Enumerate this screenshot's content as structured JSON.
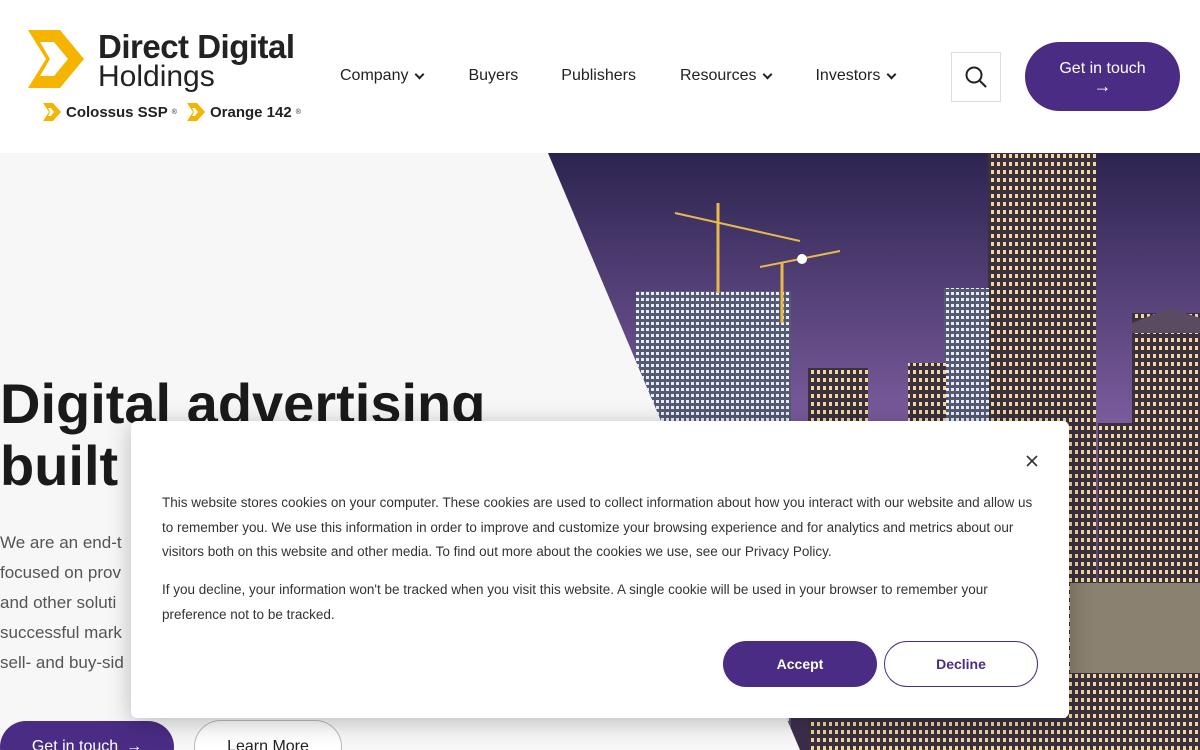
{
  "colors": {
    "brand_purple": "#4a2c85",
    "logo_yellow": "#f5b400"
  },
  "header": {
    "logo": {
      "line1": "Direct Digital",
      "line2": "Holdings",
      "sub_brands": [
        {
          "name": "Colossus SSP",
          "mark": "®"
        },
        {
          "name": "Orange 142",
          "mark": "®"
        }
      ]
    },
    "nav": [
      {
        "label": "Company",
        "has_dropdown": true
      },
      {
        "label": "Buyers",
        "has_dropdown": false
      },
      {
        "label": "Publishers",
        "has_dropdown": false
      },
      {
        "label": "Resources",
        "has_dropdown": true
      },
      {
        "label": "Investors",
        "has_dropdown": true
      }
    ],
    "search_icon": "search-icon",
    "cta_label": "Get in touch",
    "cta_arrow": "→"
  },
  "hero": {
    "title_line1": "Digital advertising",
    "title_line2": "built",
    "body_lines": [
      "We are an end-t",
      "focused on prov",
      "and other soluti",
      "successful mark",
      "sell- and buy-sid"
    ],
    "btn_primary": "Get in touch",
    "btn_primary_arrow": "→",
    "btn_secondary": "Learn More"
  },
  "cookie_banner": {
    "paragraph1": "This website stores cookies on your computer. These cookies are used to collect information about how you interact with our website and allow us to remember you. We use this information in order to improve and customize your browsing experience and for analytics and metrics about our visitors both on this website and other media. To find out more about the cookies we use, see our Privacy Policy.",
    "paragraph2": "If you decline, your information won't be tracked when you visit this website. A single cookie will be used in your browser to remember your preference not to be tracked.",
    "accept_label": "Accept",
    "decline_label": "Decline",
    "close_icon": "close-icon"
  }
}
